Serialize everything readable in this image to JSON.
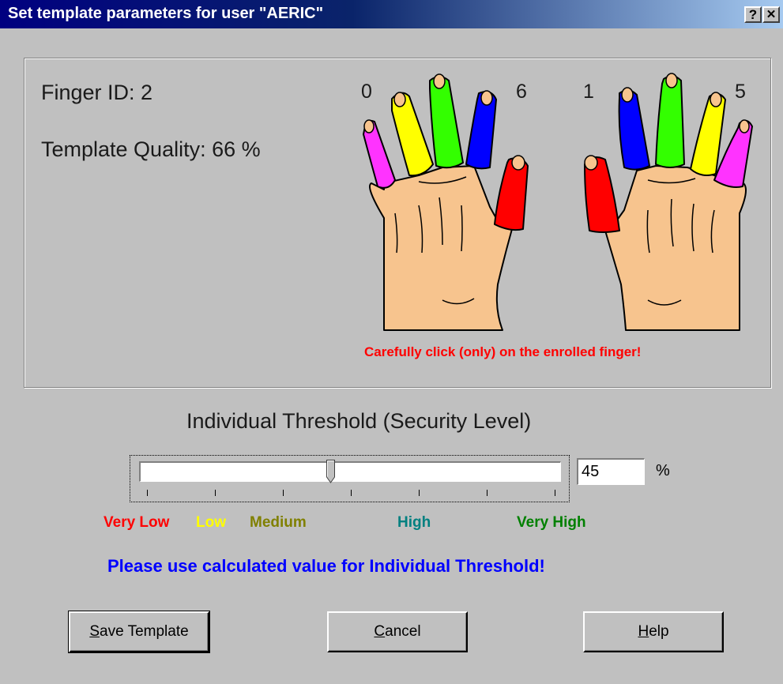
{
  "window": {
    "title": "Set template parameters for user \"AERIC\"",
    "help_glyph": "?",
    "close_glyph": "✕"
  },
  "finger_panel": {
    "finger_id": "Finger ID: 2",
    "template_quality": "Template Quality: 66 %",
    "finger_numbers": [
      "0",
      "6",
      "1",
      "5"
    ],
    "instruction": "Carefully click (only) on the enrolled finger!",
    "finger_colors": {
      "pinky": "#ff33ff",
      "ring": "#ffff00",
      "middle": "#33ff00",
      "index": "#0000ff",
      "thumb": "#ff0000",
      "skin": "#f7c48e"
    }
  },
  "threshold": {
    "title": "Individual Threshold (Security Level)",
    "value": "45",
    "value_fraction": 0.45,
    "unit": "%",
    "levels": [
      {
        "label": "Very Low",
        "color": "#ff0000"
      },
      {
        "label": "Low",
        "color": "#ffff00"
      },
      {
        "label": "Medium",
        "color": "#808000"
      },
      {
        "label": "High",
        "color": "#008080"
      },
      {
        "label": "Very High",
        "color": "#008000"
      }
    ],
    "hint": "Please use calculated value for Individual Threshold!"
  },
  "buttons": {
    "save_prefix": "S",
    "save_rest": "ave Template",
    "cancel_prefix": "C",
    "cancel_rest": "ancel",
    "help_prefix": "H",
    "help_rest": "elp"
  }
}
